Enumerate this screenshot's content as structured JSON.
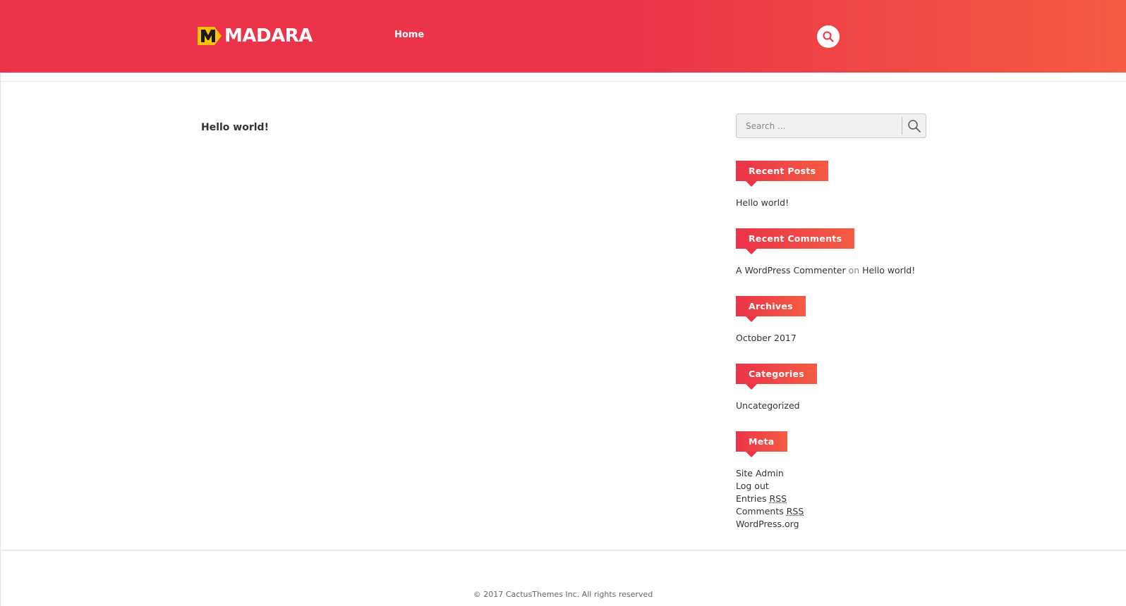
{
  "header": {
    "logo_text": "MADARA",
    "nav": [
      {
        "label": "Home"
      }
    ],
    "search_icon": "search-icon",
    "colors": {
      "gradient_start": "#eb3349",
      "gradient_end": "#f45c43",
      "logo_accent": "#ffc107"
    }
  },
  "main": {
    "post_title": "Hello world!"
  },
  "sidebar": {
    "search": {
      "placeholder": "Search ..."
    },
    "recent_posts": {
      "title": "Recent Posts",
      "items": [
        "Hello world!"
      ]
    },
    "recent_comments": {
      "title": "Recent Comments",
      "author": "A WordPress Commenter",
      "connector": "on",
      "post": "Hello world!"
    },
    "archives": {
      "title": "Archives",
      "items": [
        "October 2017"
      ]
    },
    "categories": {
      "title": "Categories",
      "items": [
        "Uncategorized"
      ]
    },
    "meta": {
      "title": "Meta",
      "site_admin": "Site Admin",
      "log_out": "Log out",
      "entries": "Entries",
      "comments": "Comments",
      "rss": "RSS",
      "wordpress": "WordPress.org"
    }
  },
  "footer": {
    "copyright": "© 2017 CactusThemes Inc. All rights reserved"
  }
}
